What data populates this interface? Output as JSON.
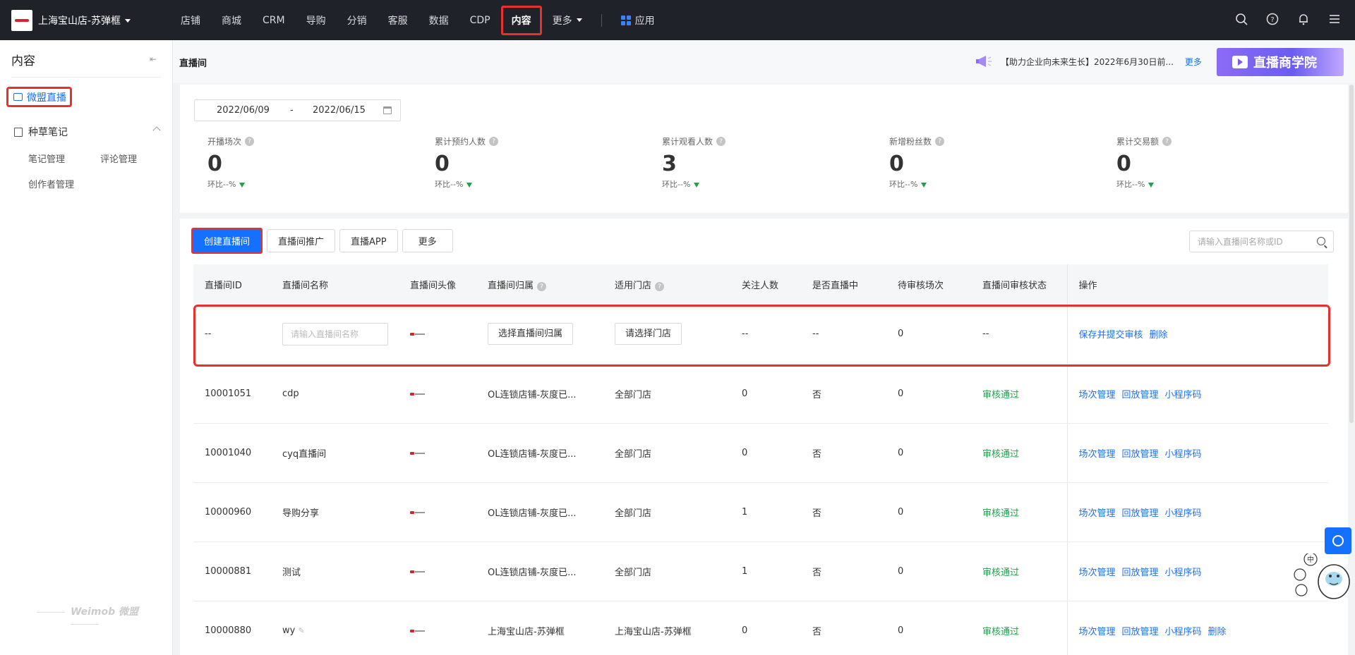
{
  "topbar": {
    "store_name": "上海宝山店-苏弹框",
    "nav": [
      "店铺",
      "商城",
      "CRM",
      "导购",
      "分销",
      "客服",
      "数据",
      "CDP",
      "内容",
      "更多"
    ],
    "active_nav": "内容",
    "apps_label": "应用"
  },
  "sidebar": {
    "title": "内容",
    "active_item": "微盟直播",
    "group": "种草笔记",
    "sub_items": [
      "笔记管理",
      "评论管理",
      "创作者管理"
    ],
    "brand": "Weimob 微盟"
  },
  "header": {
    "page_title": "直播间",
    "notice": "【助力企业向未来生长】2022年6月30日前...",
    "notice_more": "更多",
    "banner": "直播商学院"
  },
  "stats": {
    "date_start": "2022/06/09",
    "date_sep": "-",
    "date_end": "2022/06/15",
    "items": [
      {
        "label": "开播场次",
        "value": "0",
        "ratio": "环比--%"
      },
      {
        "label": "累计预约人数",
        "value": "0",
        "ratio": "环比--%"
      },
      {
        "label": "累计观看人数",
        "value": "3",
        "ratio": "环比--%"
      },
      {
        "label": "新增粉丝数",
        "value": "0",
        "ratio": "环比--%"
      },
      {
        "label": "累计交易额",
        "value": "0",
        "ratio": "环比--%"
      }
    ]
  },
  "toolbar": {
    "create": "创建直播间",
    "promote": "直播间推广",
    "app": "直播APP",
    "more": "更多",
    "search_placeholder": "请输入直播间名称或ID"
  },
  "table": {
    "headers": [
      "直播间ID",
      "直播间名称",
      "直播间头像",
      "直播间归属",
      "适用门店",
      "关注人数",
      "是否直播中",
      "待审核场次",
      "直播间审核状态",
      "操作"
    ],
    "edit_row": {
      "id": "--",
      "name_placeholder": "请输入直播间名称",
      "owner_btn": "选择直播间归属",
      "store_btn": "请选择门店",
      "followers": "--",
      "live": "--",
      "pending": "0",
      "status": "--",
      "op1": "保存并提交审核",
      "op2": "删除"
    },
    "rows": [
      {
        "id": "10001051",
        "name": "cdp",
        "owner": "OL连锁店铺-灰度已...",
        "store": "全部门店",
        "followers": "0",
        "live": "否",
        "pending": "0",
        "status": "审核通过",
        "ops": [
          "场次管理",
          "回放管理",
          "小程序码"
        ]
      },
      {
        "id": "10001040",
        "name": "cyq直播间",
        "owner": "OL连锁店铺-灰度已...",
        "store": "全部门店",
        "followers": "0",
        "live": "否",
        "pending": "0",
        "status": "审核通过",
        "ops": [
          "场次管理",
          "回放管理",
          "小程序码"
        ]
      },
      {
        "id": "10000960",
        "name": "导购分享",
        "owner": "OL连锁店铺-灰度已...",
        "store": "全部门店",
        "followers": "1",
        "live": "否",
        "pending": "0",
        "status": "审核通过",
        "ops": [
          "场次管理",
          "回放管理",
          "小程序码"
        ]
      },
      {
        "id": "10000881",
        "name": "测试",
        "owner": "OL连锁店铺-灰度已...",
        "store": "全部门店",
        "followers": "1",
        "live": "否",
        "pending": "0",
        "status": "审核通过",
        "ops": [
          "场次管理",
          "回放管理",
          "小程序码"
        ]
      },
      {
        "id": "10000880",
        "name": "wy",
        "owner": "上海宝山店-苏弹框",
        "store": "上海宝山店-苏弹框",
        "followers": "0",
        "live": "否",
        "pending": "0",
        "status": "审核通过",
        "ops": [
          "场次管理",
          "回放管理",
          "小程序码",
          "删除"
        ]
      }
    ]
  }
}
